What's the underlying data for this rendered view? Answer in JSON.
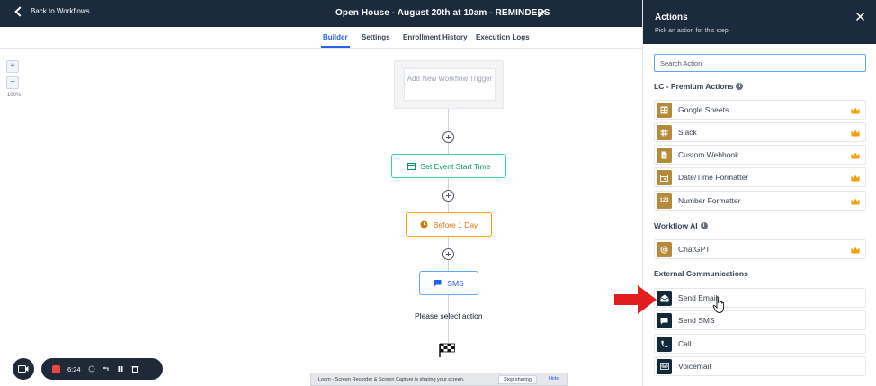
{
  "header": {
    "back_label": "Back to Workflows",
    "title": "Open House - August 20th at 10am - REMINDERS"
  },
  "tabs": [
    {
      "label": "Builder",
      "active": true
    },
    {
      "label": "Settings",
      "active": false
    },
    {
      "label": "Enrollment History",
      "active": false
    },
    {
      "label": "Execution Logs",
      "active": false
    }
  ],
  "canvas": {
    "zoom_in": "+",
    "zoom_out": "−",
    "zoom_level": "100%",
    "trigger_label": "Add New Workflow Trigger",
    "nodes": [
      {
        "label": "Set Event Start Time",
        "color": "#059669"
      },
      {
        "label": "Before 1 Day",
        "color": "#d97706"
      },
      {
        "label": "SMS",
        "color": "#2563eb"
      }
    ],
    "select_action_text": "Please select action"
  },
  "loom": {
    "timer": "6:24",
    "share_text": "Loom - Screen Recorder & Screen Capture is sharing your screen.",
    "stop_label": "Stop sharing",
    "hide_label": "Hide"
  },
  "panel": {
    "title": "Actions",
    "subtitle": "Pick an action for this step",
    "search_placeholder": "Search Action",
    "sections": [
      {
        "title": "LC - Premium Actions",
        "items": [
          {
            "label": "Google Sheets",
            "icon": "sheets-icon",
            "premium": true
          },
          {
            "label": "Slack",
            "icon": "slack-icon",
            "premium": true
          },
          {
            "label": "Custom Webhook",
            "icon": "webhook-icon",
            "premium": true
          },
          {
            "label": "Date/Time Formatter",
            "icon": "calendar-icon",
            "premium": true
          },
          {
            "label": "Number Formatter",
            "icon": "number-icon",
            "icon_text": "123",
            "premium": true
          }
        ]
      },
      {
        "title": "Workflow AI",
        "items": [
          {
            "label": "ChatGPT",
            "icon": "openai-icon",
            "premium": true
          }
        ]
      },
      {
        "title": "External Communications",
        "items": [
          {
            "label": "Send Email",
            "icon": "email-icon"
          },
          {
            "label": "Send SMS",
            "icon": "sms-icon"
          },
          {
            "label": "Call",
            "icon": "phone-icon"
          },
          {
            "label": "Voicemail",
            "icon": "voicemail-icon"
          }
        ]
      }
    ]
  },
  "colors": {
    "header_bg": "#1b2a3d",
    "accent": "#2563eb",
    "premium_icon": "#b58a3a",
    "crown": "#f59e0b",
    "annotation_arrow": "#e11d1d"
  }
}
